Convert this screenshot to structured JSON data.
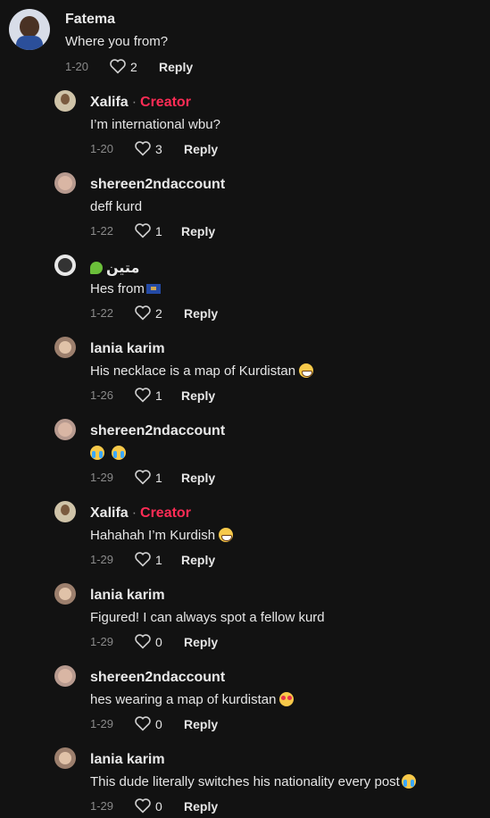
{
  "comments": [
    {
      "user": "Fatema",
      "text": "Where you from?",
      "date": "1-20",
      "likes": "2",
      "reply": "Reply"
    },
    {
      "user": "Xalifa",
      "creator": "Creator",
      "text": "I’m international wbu?",
      "date": "1-20",
      "likes": "3",
      "reply": "Reply"
    },
    {
      "user": "shereen2ndaccount",
      "text": "deff kurd",
      "date": "1-22",
      "likes": "1",
      "reply": "Reply"
    },
    {
      "user": "متين",
      "text": "Hes from",
      "date": "1-22",
      "likes": "2",
      "reply": "Reply"
    },
    {
      "user": "lania karim",
      "text": "His necklace is a map of Kurdistan",
      "date": "1-26",
      "likes": "1",
      "reply": "Reply"
    },
    {
      "user": "shereen2ndaccount",
      "text": "",
      "date": "1-29",
      "likes": "1",
      "reply": "Reply"
    },
    {
      "user": "Xalifa",
      "creator": "Creator",
      "text": "Hahahah I’m Kurdish",
      "date": "1-29",
      "likes": "1",
      "reply": "Reply"
    },
    {
      "user": "lania karim",
      "text": "Figured! I can always spot a fellow kurd",
      "date": "1-29",
      "likes": "0",
      "reply": "Reply"
    },
    {
      "user": "shereen2ndaccount",
      "text": "hes wearing a map of kurdistan",
      "date": "1-29",
      "likes": "0",
      "reply": "Reply"
    },
    {
      "user": "lania karim",
      "text": "This dude literally switches his nationality every post",
      "date": "1-29",
      "likes": "0",
      "reply": "Reply"
    }
  ],
  "colors": {
    "creator": "#fe2c55",
    "background": "#121212",
    "meta": "#8a8a8a"
  }
}
